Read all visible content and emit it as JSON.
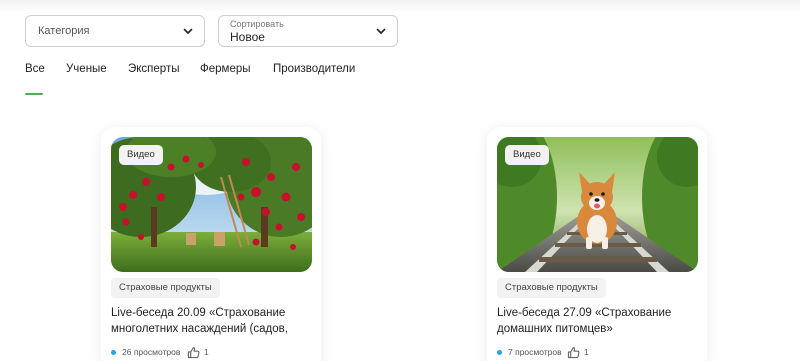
{
  "filters": {
    "category": {
      "placeholder": "Категория"
    },
    "sort": {
      "label": "Сортировать",
      "value": "Новое"
    }
  },
  "tabs": [
    {
      "label": "Все",
      "active": true
    },
    {
      "label": "Ученые",
      "active": false
    },
    {
      "label": "Эксперты",
      "active": false
    },
    {
      "label": "Фермеры",
      "active": false
    },
    {
      "label": "Производители",
      "active": false
    }
  ],
  "colors": {
    "accent": "#4caf50",
    "views_dot": "#1fa9df"
  },
  "cards": [
    {
      "badge": "Видео",
      "tag": "Страховые продукты",
      "title": "Live-беседа 20.09 «Страхование многолетних насаждений (садов,",
      "views": "26 просмотров",
      "likes": "1",
      "image": "apple-orchard"
    },
    {
      "badge": "Видео",
      "tag": "Страховые продукты",
      "title": "Live-беседа 27.09 «Страхование домашних питомцев»",
      "views": "7 просмотров",
      "likes": "1",
      "image": "corgi-on-railway"
    }
  ]
}
